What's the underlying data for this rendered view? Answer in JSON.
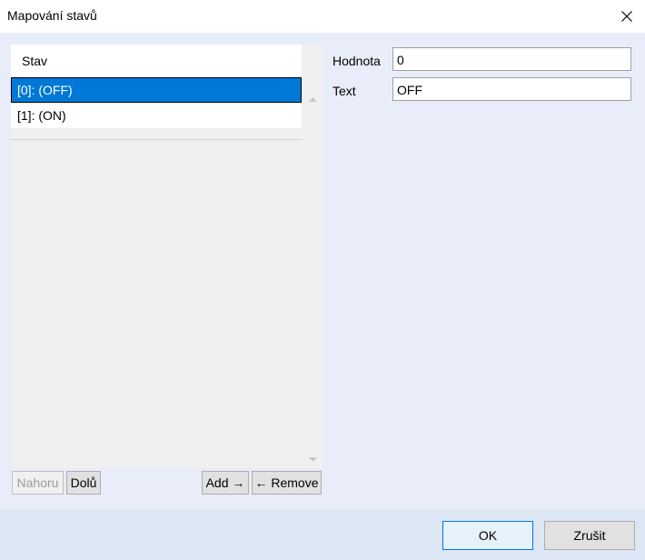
{
  "window": {
    "title": "Mapování stavů",
    "close_icon": "close-icon"
  },
  "list": {
    "header": "Stav",
    "items": [
      {
        "label": "[0]: (OFF)",
        "selected": true
      },
      {
        "label": "[1]: (ON)",
        "selected": false
      }
    ]
  },
  "list_buttons": {
    "up_label": "Nahoru",
    "down_label": "Dolů",
    "add_label": "Add →",
    "remove_label": "← Remove"
  },
  "properties": {
    "value_label": "Hodnota",
    "value": "0",
    "text_label": "Text",
    "text": "OFF"
  },
  "footer": {
    "ok_label": "OK",
    "cancel_label": "Zrušit"
  },
  "colors": {
    "accent": "#0078d7",
    "content_bg": "#e9edf9",
    "footer_bg": "#dce6f5"
  }
}
